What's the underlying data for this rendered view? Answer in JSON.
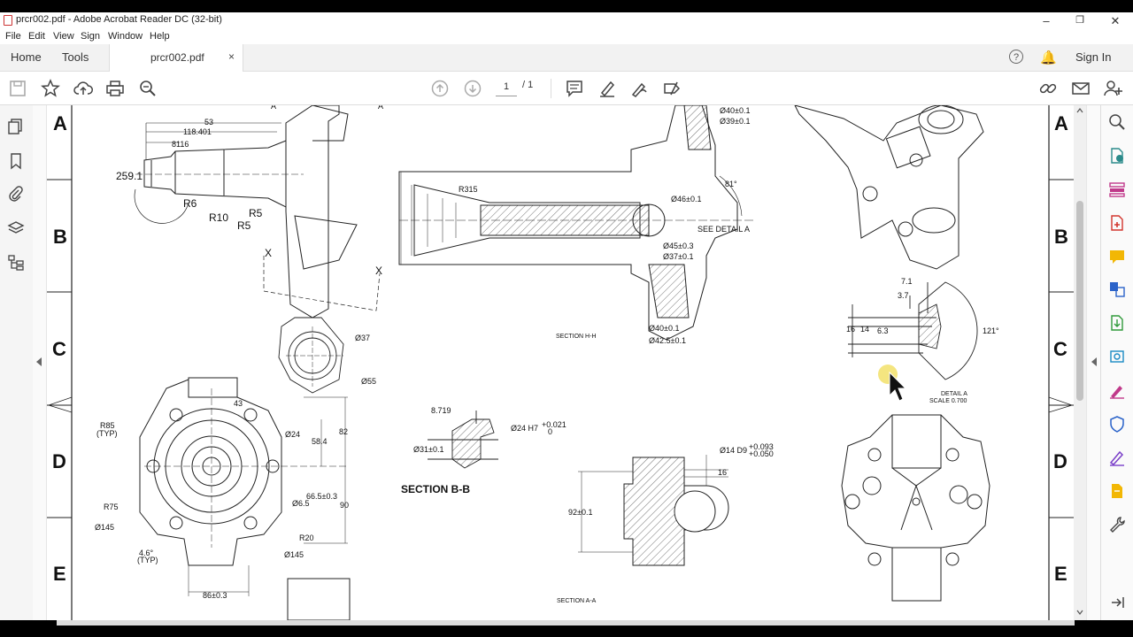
{
  "window": {
    "title": "prcr002.pdf - Adobe Acrobat Reader DC (32-bit)",
    "controls": [
      "–",
      "❐",
      "✕"
    ]
  },
  "menu": [
    "File",
    "Edit",
    "View",
    "Sign",
    "Window",
    "Help"
  ],
  "tabs": {
    "home": "Home",
    "tools": "Tools",
    "document": "prcr002.pdf",
    "close_glyph": "×",
    "help_glyph": "?",
    "sign_in": "Sign In"
  },
  "toolbar": {
    "current_page": "1",
    "page_total": "/ 1"
  },
  "drawing": {
    "zones_left": [
      "A",
      "B",
      "C",
      "D",
      "E"
    ],
    "zones_right": [
      "A",
      "B",
      "C",
      "D",
      "E"
    ],
    "dims": {
      "d53": "53",
      "d118": "118.401",
      "d8116": "8116",
      "d259": "259.1",
      "r6": "R6",
      "r10": "R10",
      "r5a": "R5",
      "r5b": "R5",
      "x1": "X",
      "x2": "X",
      "a1": "A",
      "a2": "A",
      "r315": "R315",
      "d40": "Ø40±0.1",
      "d39": "Ø39±0.1",
      "d46": "Ø46±0.1",
      "d45": "Ø45±0.3",
      "d37b": "Ø37±0.1",
      "d40b": "Ø40±0.1",
      "d425": "Ø42.5±0.1",
      "ang81": "81°",
      "see_detail": "SEE DETAIL A",
      "d37": "Ø37",
      "d55": "Ø55",
      "d43": "43",
      "r85": "R85",
      "typ1": "(TYP)",
      "d24": "Ø24",
      "d82": "82",
      "d584": "58.4",
      "d665": "66.5±0.3",
      "d90": "90",
      "r75": "R75",
      "d65": "Ø6.5",
      "d145a": "Ø145",
      "r20": "R20",
      "d145b": "Ø145",
      "ang46": "4.6°",
      "typ2": "(TYP)",
      "d86": "86±0.3",
      "d8719": "8.719",
      "d24h7": "Ø24 H7",
      "tol1": "+0.021",
      "tol0": "0",
      "d31": "Ø31±0.1",
      "d14d9": "Ø14 D9",
      "tol2": "+0.093",
      "tol3": "+0.050",
      "d16": "16",
      "d92": "92±0.1",
      "d71": "7.1",
      "d37c": "3.7",
      "d16b": "16",
      "d14": "14",
      "d63": "6.3",
      "ang121": "121°",
      "detail_a": "DETAIL A",
      "scale": "SCALE 0.700"
    },
    "sections": {
      "hh": "SECTION H-H",
      "bb": "SECTION  B-B",
      "aa": "SECTION A-A"
    }
  }
}
